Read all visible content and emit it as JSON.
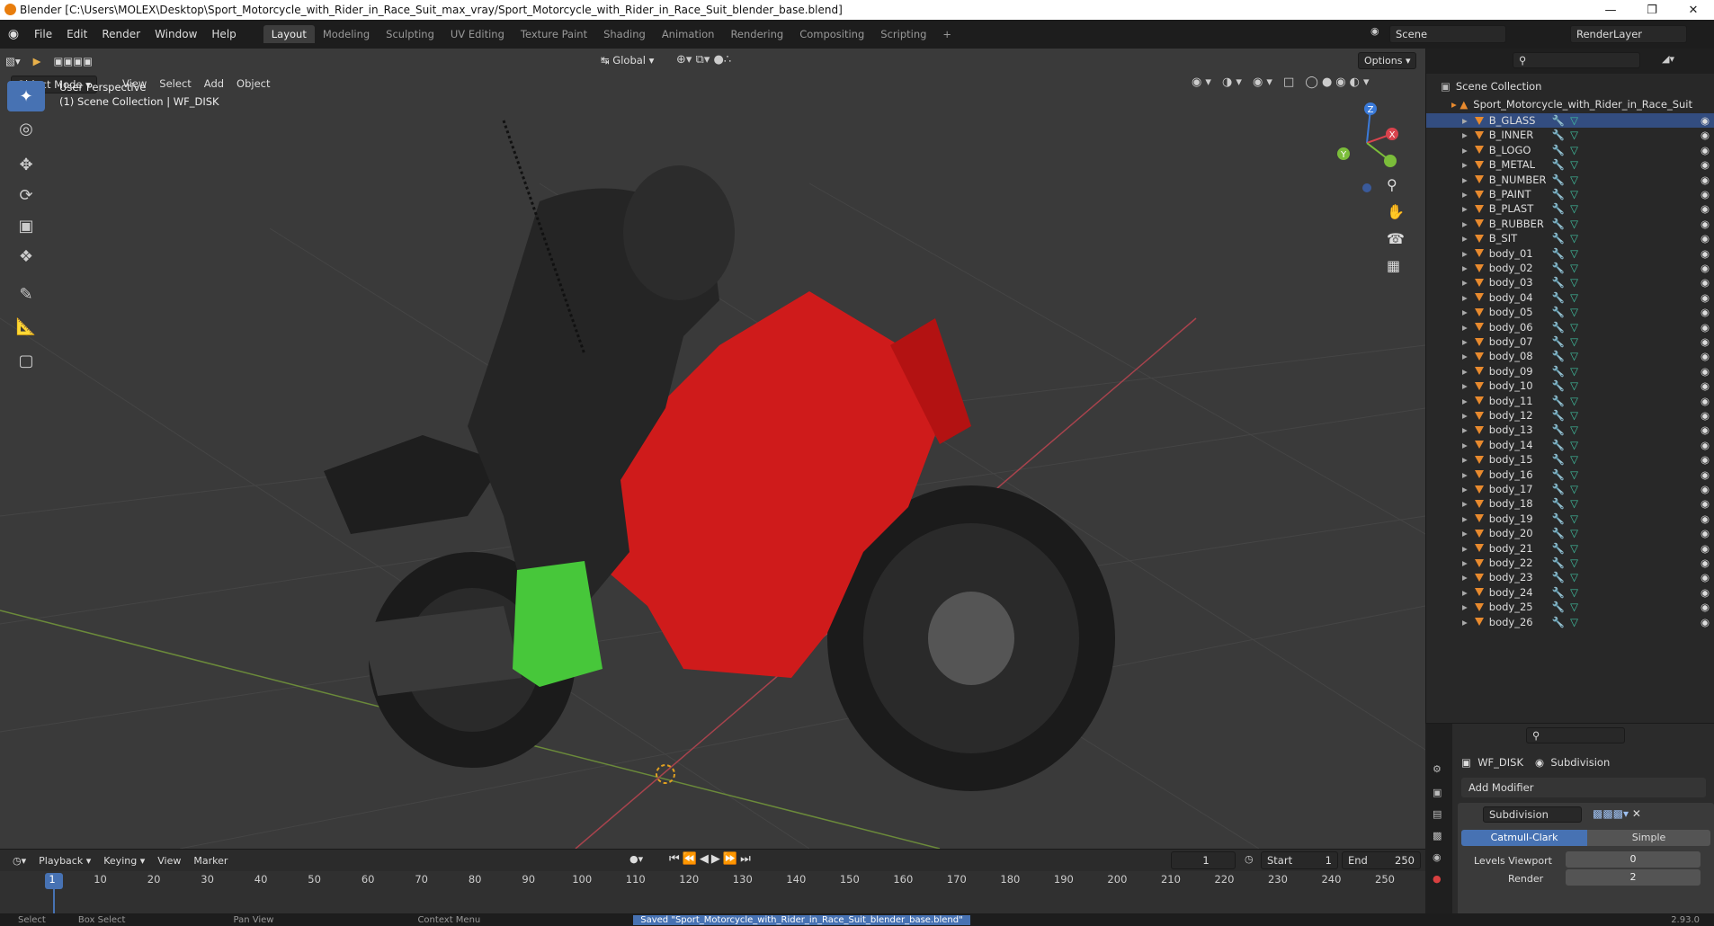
{
  "window": {
    "title": "Blender [C:\\Users\\MOLEX\\Desktop\\Sport_Motorcycle_with_Rider_in_Race_Suit_max_vray/Sport_Motorcycle_with_Rider_in_Race_Suit_blender_base.blend]"
  },
  "menu": [
    "File",
    "Edit",
    "Render",
    "Window",
    "Help"
  ],
  "workspaces": [
    "Layout",
    "Modeling",
    "Sculpting",
    "UV Editing",
    "Texture Paint",
    "Shading",
    "Animation",
    "Rendering",
    "Compositing",
    "Scripting"
  ],
  "active_workspace": "Layout",
  "scene": "Scene",
  "render_layer": "RenderLayer",
  "viewport": {
    "mode": "Object Mode",
    "menus": [
      "View",
      "Select",
      "Add",
      "Object"
    ],
    "transform": "Global",
    "options": "Options",
    "overlay_line1": "User Perspective",
    "overlay_line2": "(1) Scene Collection | WF_DISK",
    "gizmo": {
      "x": "X",
      "y": "Y",
      "z": "Z"
    }
  },
  "outliner": {
    "root": "Scene Collection",
    "collection": "Sport_Motorcycle_with_Rider_in_Race_Suit",
    "items": [
      "B_GLASS",
      "B_INNER",
      "B_LOGO",
      "B_METAL",
      "B_NUMBER",
      "B_PAINT",
      "B_PLAST",
      "B_RUBBER",
      "B_SIT",
      "body_01",
      "body_02",
      "body_03",
      "body_04",
      "body_05",
      "body_06",
      "body_07",
      "body_08",
      "body_09",
      "body_10",
      "body_11",
      "body_12",
      "body_13",
      "body_14",
      "body_15",
      "body_16",
      "body_17",
      "body_18",
      "body_19",
      "body_20",
      "body_21",
      "body_22",
      "body_23",
      "body_24",
      "body_25",
      "body_26"
    ]
  },
  "properties": {
    "object": "WF_DISK",
    "modifier_tab": "Subdivision",
    "add_modifier": "Add Modifier",
    "modifier_name": "Subdivision",
    "type_a": "Catmull-Clark",
    "type_b": "Simple",
    "levels_viewport_label": "Levels Viewport",
    "levels_viewport": "0",
    "render_label": "Render",
    "render": "2"
  },
  "timeline": {
    "menus": [
      "Playback",
      "Keying",
      "View",
      "Marker"
    ],
    "current_frame": "1",
    "start_label": "Start",
    "start": "1",
    "end_label": "End",
    "end": "250",
    "ticks": [
      "1",
      "10",
      "20",
      "30",
      "40",
      "50",
      "60",
      "70",
      "80",
      "90",
      "100",
      "110",
      "120",
      "130",
      "140",
      "150",
      "160",
      "170",
      "180",
      "190",
      "200",
      "210",
      "220",
      "230",
      "240",
      "250"
    ]
  },
  "status": {
    "select": "Select",
    "box_select": "Box Select",
    "pan_view": "Pan View",
    "context_menu": "Context Menu",
    "message": "Saved \"Sport_Motorcycle_with_Rider_in_Race_Suit_blender_base.blend\"",
    "version": "2.93.0"
  }
}
